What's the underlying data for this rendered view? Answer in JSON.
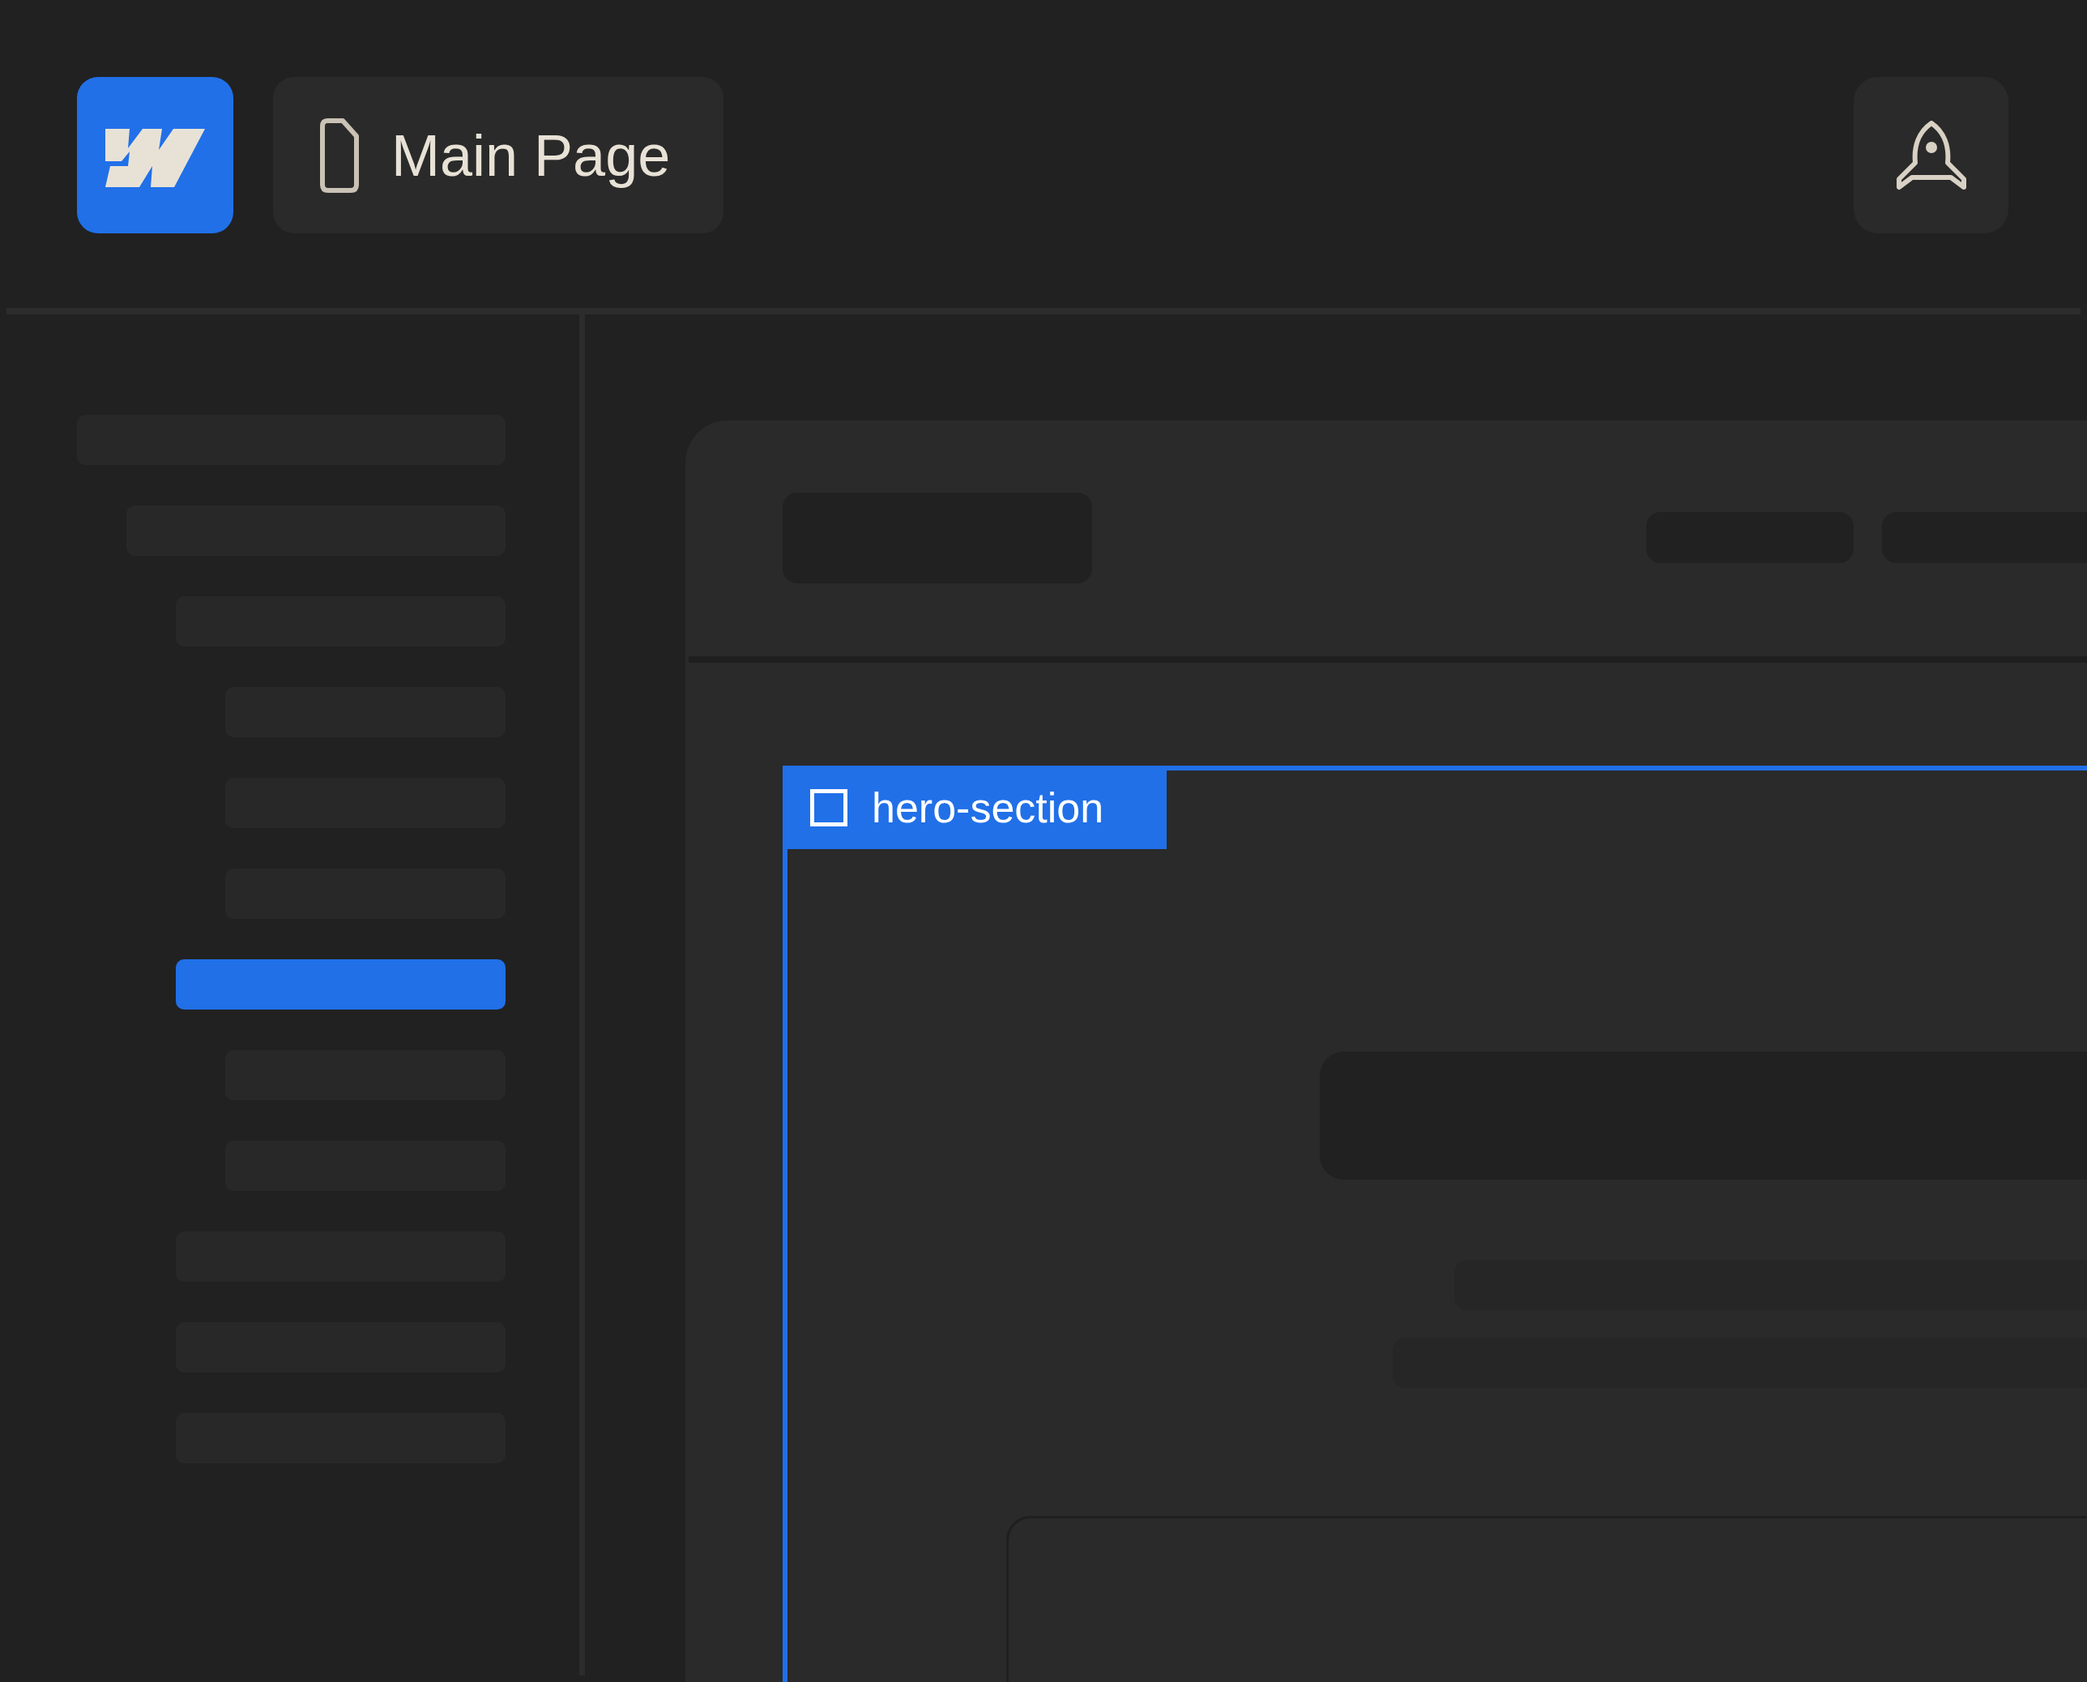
{
  "header": {
    "page_title": "Main Page"
  },
  "sidebar": {
    "items": [
      {
        "selected": false,
        "children": [
          {
            "selected": false,
            "children": [
              {
                "selected": false,
                "children": [
                  {
                    "selected": false
                  },
                  {
                    "selected": false
                  },
                  {
                    "selected": false
                  }
                ]
              },
              {
                "selected": true,
                "children": [
                  {
                    "selected": false
                  },
                  {
                    "selected": false
                  }
                ]
              },
              {
                "selected": false
              },
              {
                "selected": false
              },
              {
                "selected": false
              }
            ]
          }
        ]
      }
    ]
  },
  "canvas": {
    "selection": {
      "label": "hero-section"
    }
  }
}
